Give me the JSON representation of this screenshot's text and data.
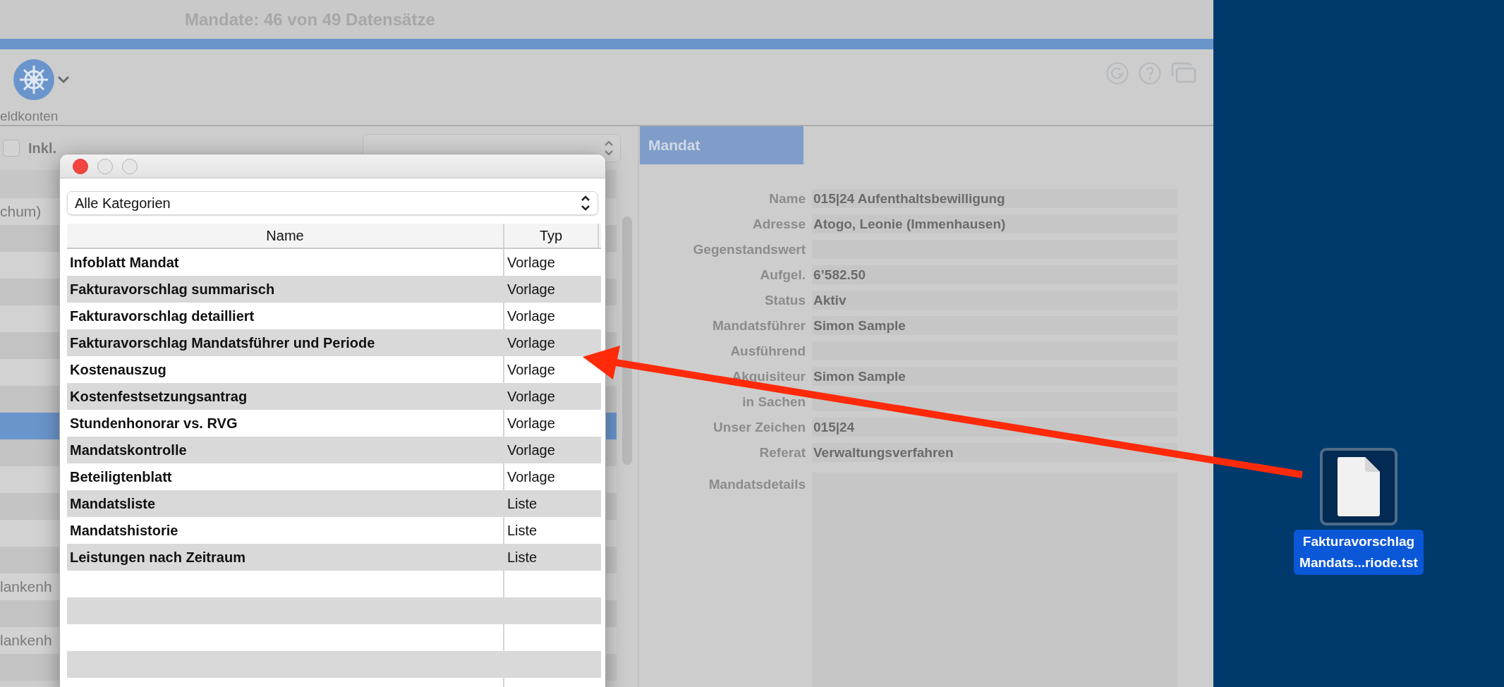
{
  "window": {
    "title": "Mandate: 46 von 49 Datensätze"
  },
  "toolbar": {
    "label": "eldkonten"
  },
  "filter": {
    "checkbox_label": "Inkl.",
    "checked": false
  },
  "list": {
    "rows": [
      {
        "text": "chum)",
        "selected": false
      },
      {
        "selected": false
      },
      {
        "selected": false
      },
      {
        "selected": false
      },
      {
        "selected": false
      },
      {
        "selected": false
      },
      {
        "selected": false
      },
      {
        "selected": false
      },
      {
        "selected": true
      },
      {
        "selected": false
      },
      {
        "selected": false
      },
      {
        "selected": false
      },
      {
        "selected": false
      },
      {
        "selected": false
      },
      {
        "text": "lankenh",
        "selected": false
      },
      {
        "selected": false
      },
      {
        "text": "lankenh",
        "selected": false
      },
      {
        "selected": false
      }
    ]
  },
  "panel": {
    "tab": "Mandat",
    "fields": [
      {
        "label": "Name",
        "value": "015|24 Aufenthaltsbewilligung"
      },
      {
        "label": "Adresse",
        "value": "Atogo, Leonie (Immenhausen)"
      },
      {
        "label": "Gegenstandswert"
      },
      {
        "label": "Aufgel.",
        "value": "6’582.50"
      },
      {
        "label": "Status",
        "value": "Aktiv"
      },
      {
        "label": "Mandatsführer",
        "value": "Simon Sample"
      },
      {
        "label": "Ausführend"
      },
      {
        "label": "Akquisiteur",
        "value": "Simon Sample"
      },
      {
        "label": "in Sachen"
      },
      {
        "label": "Unser Zeichen",
        "value": "015|24"
      },
      {
        "label": "Referat",
        "value": "Verwaltungsverfahren"
      }
    ],
    "details_label": "Mandatsdetails"
  },
  "dialog": {
    "category": "Alle Kategorien",
    "columns": [
      "Name",
      "Typ"
    ],
    "rows": [
      {
        "name": "Infoblatt Mandat",
        "type": "Vorlage"
      },
      {
        "name": "Fakturavorschlag summarisch",
        "type": "Vorlage"
      },
      {
        "name": "Fakturavorschlag detailliert",
        "type": "Vorlage"
      },
      {
        "name": "Fakturavorschlag Mandatsführer und Periode",
        "type": "Vorlage"
      },
      {
        "name": "Kostenauszug",
        "type": "Vorlage"
      },
      {
        "name": "Kostenfestsetzungsantrag",
        "type": "Vorlage"
      },
      {
        "name": "Stundenhonorar vs. RVG",
        "type": "Vorlage"
      },
      {
        "name": "Mandatskontrolle",
        "type": "Vorlage"
      },
      {
        "name": "Beteiligtenblatt",
        "type": "Vorlage"
      },
      {
        "name": "Mandatsliste",
        "type": "Liste"
      },
      {
        "name": "Mandatshistorie",
        "type": "Liste"
      },
      {
        "name": "Leistungen nach Zeitraum",
        "type": "Liste"
      }
    ]
  },
  "desktop": {
    "file": {
      "name": "Fakturavorschlag Mandats...riode.tst",
      "selected": true
    }
  }
}
